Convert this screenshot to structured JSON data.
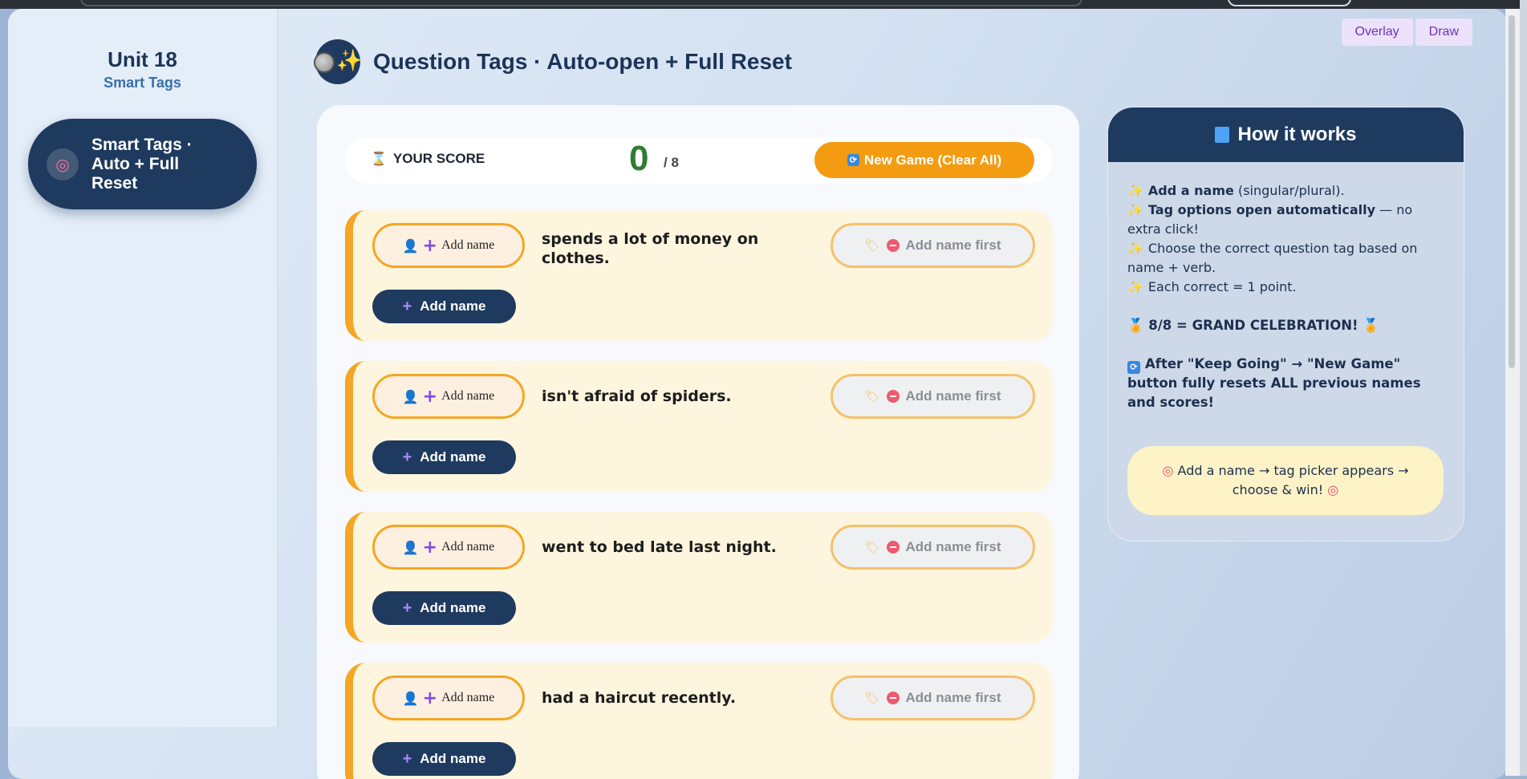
{
  "overlay_controls": {
    "overlay": "Overlay",
    "draw": "Draw"
  },
  "sidebar": {
    "unit_title": "Unit 18",
    "unit_subtitle": "Smart Tags",
    "items": [
      {
        "label": "Smart Tags · Auto + Full Reset",
        "icon": "target-icon",
        "active": true
      }
    ]
  },
  "header": {
    "title": "Question Tags · Auto-open + Full Reset",
    "icon": "moon-sparkle-icon"
  },
  "score": {
    "label": "YOUR SCORE",
    "value": "0",
    "max": "/ 8"
  },
  "new_game_button": "New Game (Clear All)",
  "questions": [
    {
      "name_placeholder": "Add name",
      "sentence": "spends a lot of money on clothes.",
      "tag_status": "Add name first",
      "add_button": "Add name"
    },
    {
      "name_placeholder": "Add name",
      "sentence": "isn't afraid of spiders.",
      "tag_status": "Add name first",
      "add_button": "Add name"
    },
    {
      "name_placeholder": "Add name",
      "sentence": "went to bed late last night.",
      "tag_status": "Add name first",
      "add_button": "Add name"
    },
    {
      "name_placeholder": "Add name",
      "sentence": "had a haircut recently.",
      "tag_status": "Add name first",
      "add_button": "Add name"
    }
  ],
  "how_it_works": {
    "title": "How it works",
    "step1_bold": "Add a name",
    "step1_rest": "(singular/plural).",
    "step2_bold": "Tag options open automatically",
    "step2_rest": "— no extra click!",
    "step3": "Choose the correct question tag based on name + verb.",
    "step4": "Each correct = 1 point.",
    "celebration": "8/8 = GRAND CELEBRATION!",
    "reset_note": "After \"Keep Going\" → \"New Game\" button fully resets ALL previous names and scores!",
    "tip": "Add a name → tag picker appears → choose & win!"
  },
  "colors": {
    "navy": "#1f3a5f",
    "accent_orange": "#f39c12",
    "score_green": "#2f7d32",
    "card_bg": "#fdf5dd"
  }
}
